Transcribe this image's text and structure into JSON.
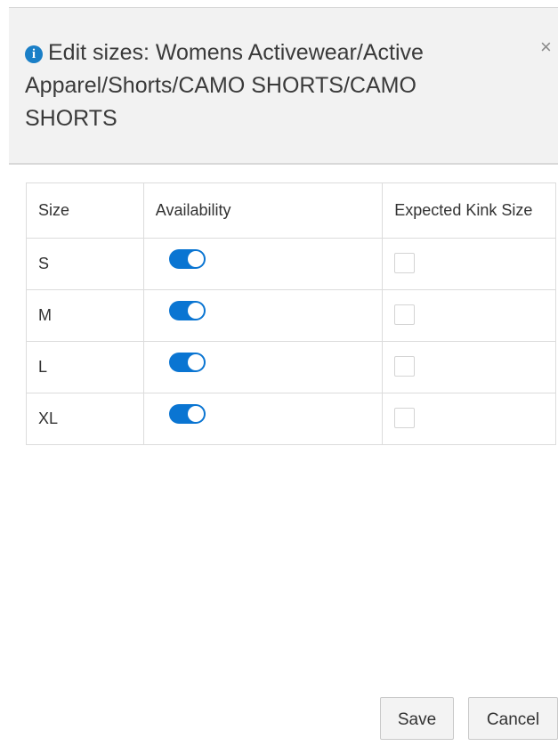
{
  "dialog": {
    "title": "Edit sizes: Womens Activewear/Active Apparel/Shorts/CAMO SHORTS/CAMO SHORTS",
    "info_icon": "info-circle-icon",
    "close_label": "×"
  },
  "table": {
    "headers": {
      "size": "Size",
      "availability": "Availability",
      "kink": "Expected Kink Size"
    },
    "rows": [
      {
        "size": "S",
        "available": true,
        "expected_kink": false
      },
      {
        "size": "M",
        "available": true,
        "expected_kink": false
      },
      {
        "size": "L",
        "available": true,
        "expected_kink": false
      },
      {
        "size": "XL",
        "available": true,
        "expected_kink": false
      }
    ]
  },
  "footer": {
    "save_label": "Save",
    "cancel_label": "Cancel"
  },
  "colors": {
    "accent": "#0a75d2",
    "header_bg": "#f2f2f2"
  }
}
